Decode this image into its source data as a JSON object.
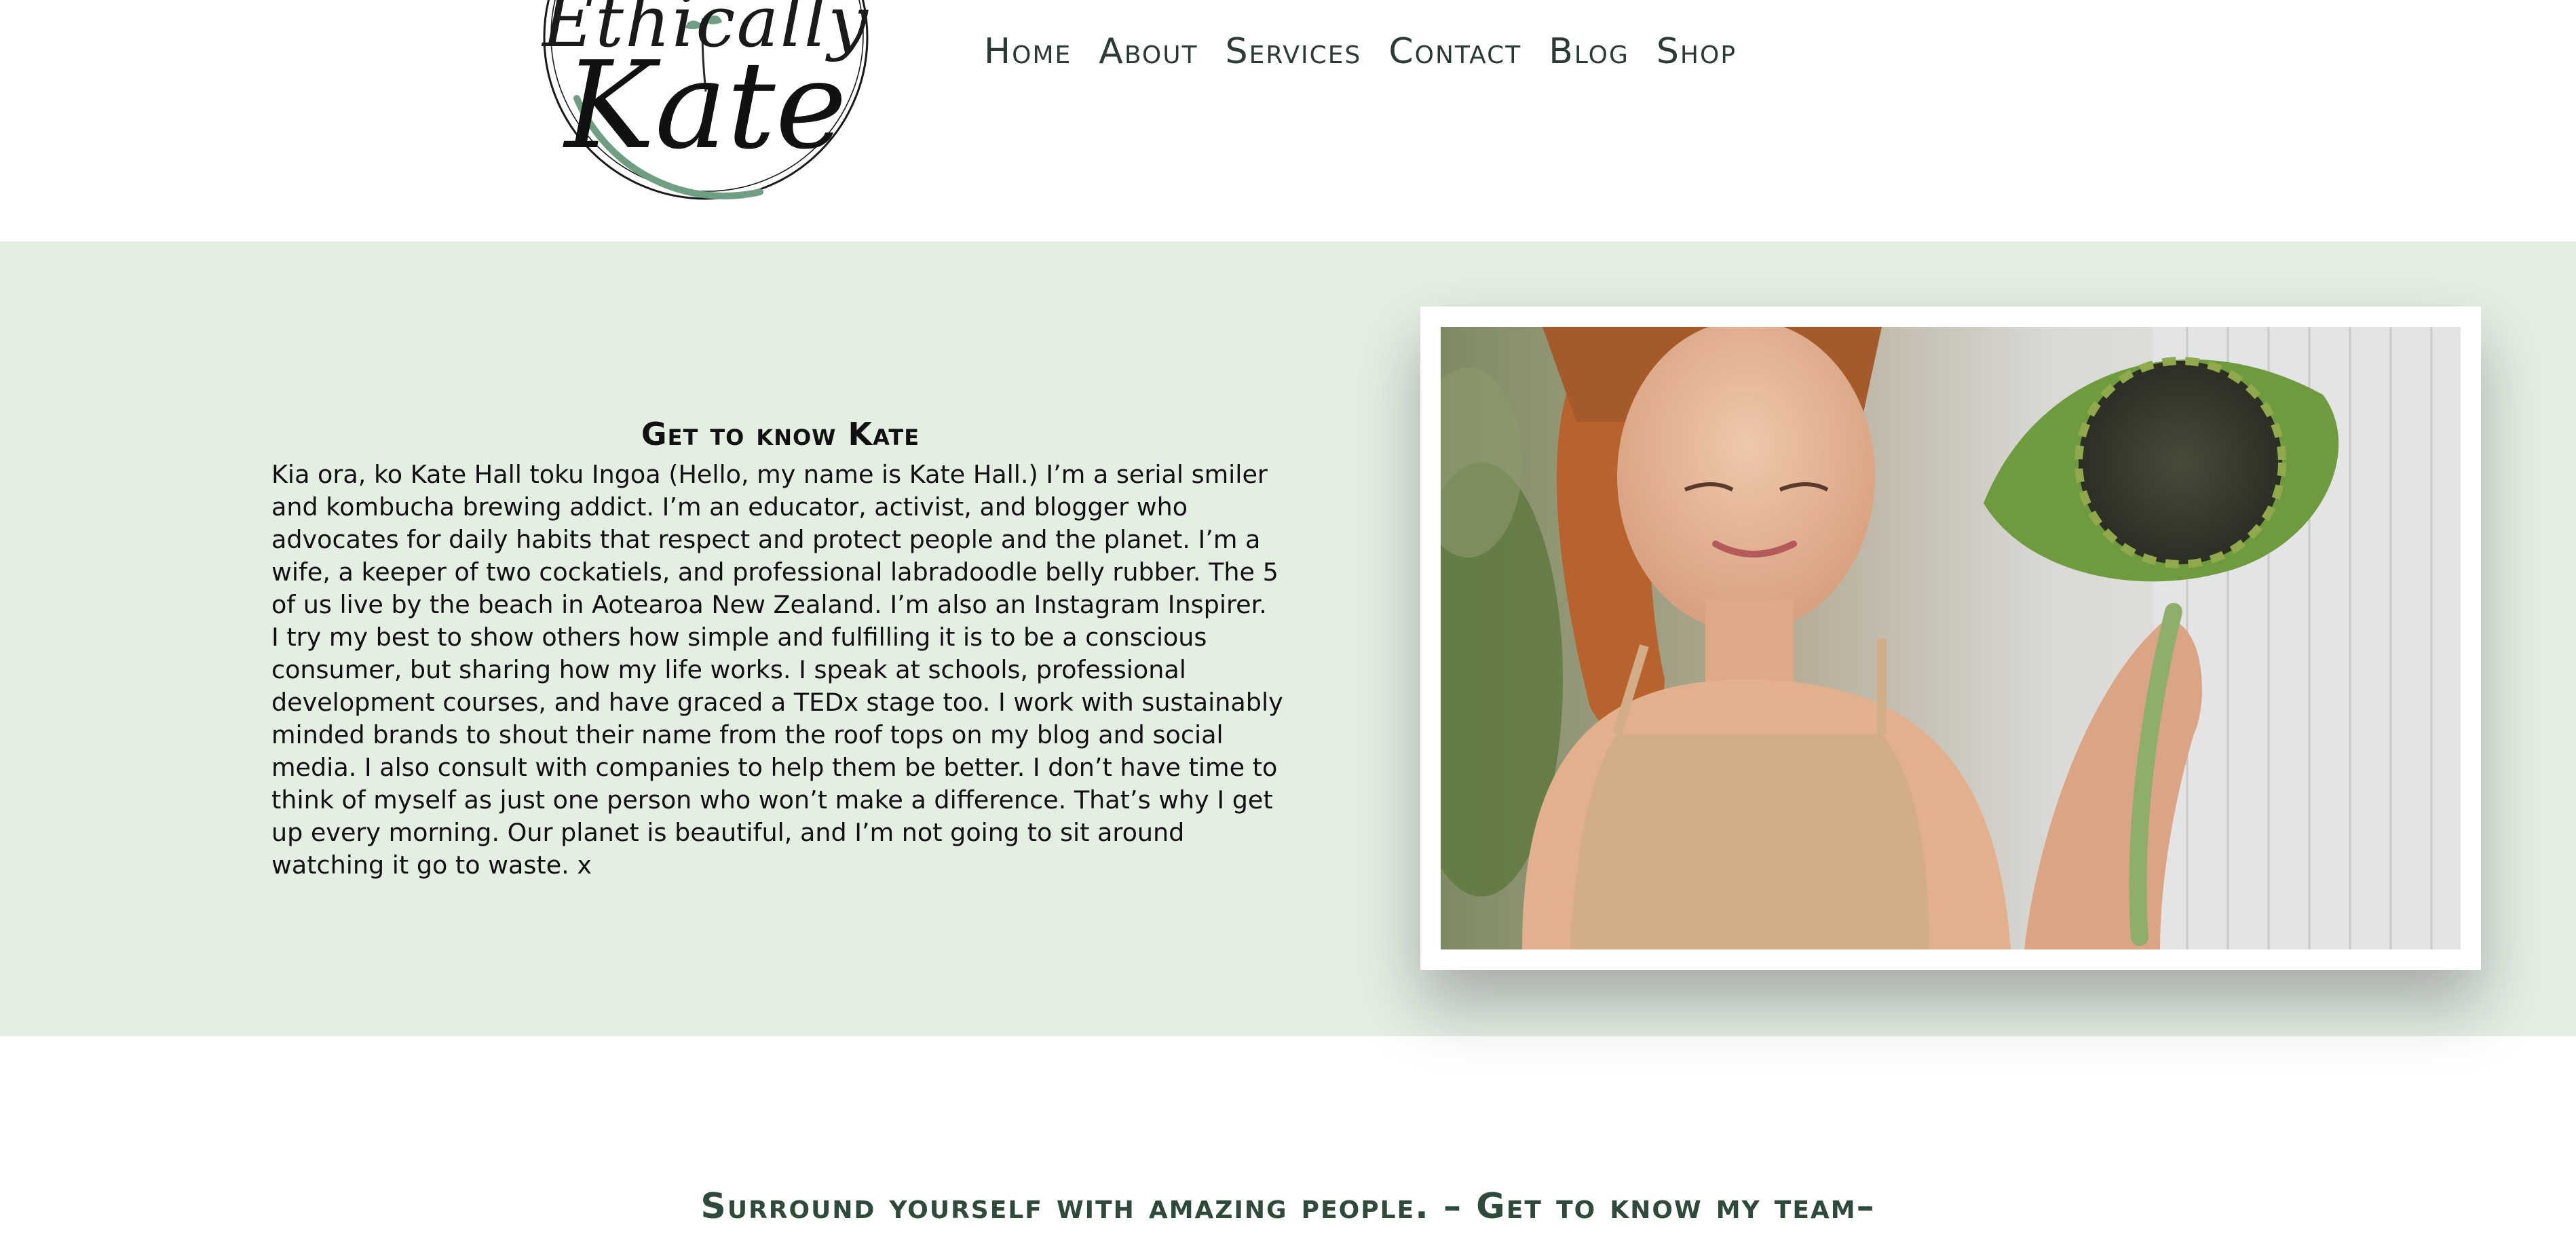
{
  "colors": {
    "band_background": "#e4eee3",
    "nav_text": "#2b3a33",
    "logo_accent": "#6f9e83",
    "team_text": "#2f4a3a"
  },
  "logo": {
    "top_word": "Ethically",
    "main_word": "Kate"
  },
  "nav": {
    "items": [
      "Home",
      "About",
      "Services",
      "Contact",
      "Blog",
      "Shop"
    ]
  },
  "about": {
    "heading": "Get to know Kate",
    "paragraph_1": "Kia ora, ko Kate Hall toku Ingoa (Hello, my name is Kate Hall.) I’m a serial smiler and kombucha brewing addict. I’m an educator, activist, and blogger who advocates for daily habits that respect and protect people and the planet. I’m a wife, a keeper of two cockatiels, and professional labradoodle belly rubber. The 5 of us live by the beach in Aotearoa New Zealand. I’m also an Instagram Inspirer.",
    "paragraph_2": "I try my best to show others how simple and fulfilling it is to be a conscious consumer, but sharing how my life works. I speak at schools, professional development courses, and have graced a TEDx stage too. I work with sustainably minded brands to shout their name from the roof tops on my blog and social media. I also consult with companies to help them be better. I don’t have time to think of myself as just one person who won’t make a difference. That’s why I get up every morning. Our planet is beautiful, and I’m not going to sit around watching it go to waste. x",
    "photo_icon": "portrait-photo"
  },
  "team": {
    "tagline": "Surround yourself with amazing people. – Get to know my team–"
  }
}
